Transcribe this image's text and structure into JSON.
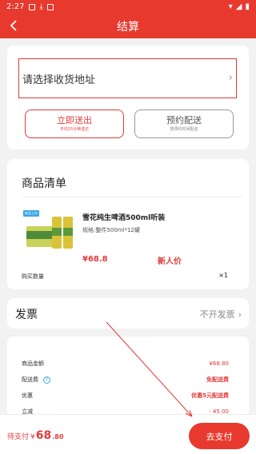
{
  "status_bar": {
    "time": "2:27"
  },
  "header": {
    "title": "结算"
  },
  "address": {
    "placeholder": "请选择收货地址"
  },
  "delivery": {
    "now": {
      "label": "立即送出",
      "sub": "平均15分钟送达"
    },
    "scheduled": {
      "label": "预约配送",
      "sub": "按预约时间配送"
    }
  },
  "goods": {
    "title": "商品清单",
    "tag": "新品上市",
    "item": {
      "name": "雪花纯生啤酒500ml听装",
      "spec": "规格:整件500ml*12罐",
      "price": "¥68.8",
      "new_price_label": "新人价",
      "qty_label": "购买数量",
      "qty": "×1"
    }
  },
  "invoice": {
    "label": "发票",
    "value": "不开发票"
  },
  "summary": {
    "rows": [
      {
        "label": "商品金额",
        "value": "¥68.80"
      },
      {
        "label": "配送费",
        "value": "免配送费"
      },
      {
        "label": "优惠",
        "value": "优惠5元配送费"
      },
      {
        "label": "立减",
        "value": "- ¥5.00"
      }
    ]
  },
  "footer": {
    "to_pay_label": "待支付",
    "currency": "¥",
    "amount_int": "68",
    "amount_dec": ".80",
    "pay_button": "去支付"
  },
  "colors": {
    "accent": "#e8392e",
    "info": "#3aa7e8"
  }
}
